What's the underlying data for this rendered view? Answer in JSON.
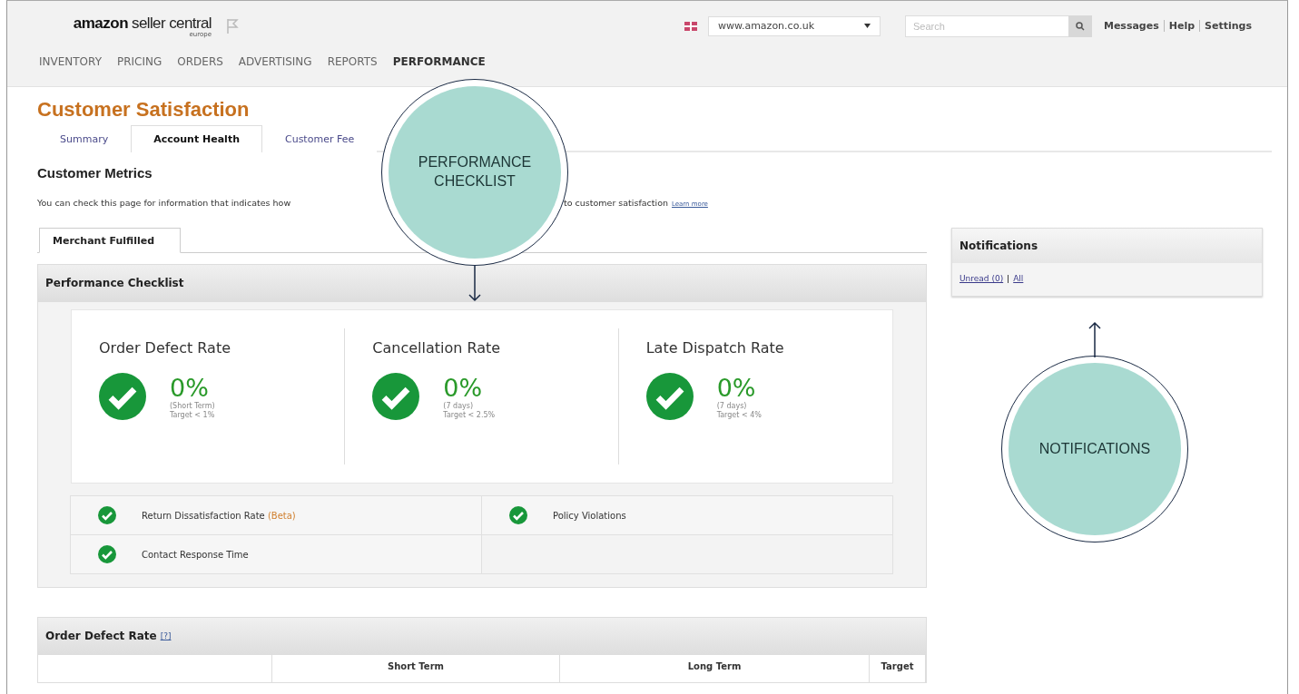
{
  "header": {
    "logo": {
      "brand": "amazon",
      "product": "seller central",
      "region": "europe"
    },
    "marketplace": "www.amazon.co.uk",
    "search": {
      "placeholder": "Search"
    },
    "links": [
      "Messages",
      "Help",
      "Settings"
    ]
  },
  "nav": [
    {
      "label": "INVENTORY",
      "selected": false
    },
    {
      "label": "PRICING",
      "selected": false
    },
    {
      "label": "ORDERS",
      "selected": false
    },
    {
      "label": "ADVERTISING",
      "selected": false
    },
    {
      "label": "REPORTS",
      "selected": false
    },
    {
      "label": "PERFORMANCE",
      "selected": true
    }
  ],
  "page_title": "Customer Satisfaction",
  "tabs": [
    {
      "label": "Summary",
      "selected": false
    },
    {
      "label": "Account Health",
      "selected": true
    },
    {
      "label": "Customer Fee",
      "selected": false
    }
  ],
  "section_title": "Customer Metrics",
  "description": [
    "You can check this page for information that indicates how",
    "to customer satisfaction"
  ],
  "learn_more": "Learn more",
  "subtabs": [
    {
      "label": "Merchant Fulfilled",
      "selected": true
    }
  ],
  "checklist": {
    "title": "Performance Checklist",
    "metrics": [
      {
        "name": "Order Defect Rate",
        "value": "0%",
        "period": "(Short Term)",
        "target": "Target < 1%",
        "passed": true
      },
      {
        "name": "Cancellation Rate",
        "value": "0%",
        "period": "(7 days)",
        "target": "Target < 2.5%",
        "passed": true
      },
      {
        "name": "Late Dispatch Rate",
        "value": "0%",
        "period": "(7 days)",
        "target": "Target < 4%",
        "passed": true
      }
    ],
    "items": [
      {
        "label": "Return Dissatisfaction Rate",
        "tag": "(Beta)",
        "passed": true
      },
      {
        "label": "Policy Violations",
        "passed": true
      },
      {
        "label": "Contact Response Time",
        "passed": true
      }
    ]
  },
  "notifications": {
    "title": "Notifications",
    "links": [
      "Unread (0)",
      "All"
    ]
  },
  "odr_panel": {
    "title": "Order Defect Rate",
    "help": "[?]",
    "columns": [
      "",
      "Short Term",
      "Long Term",
      "Target"
    ]
  },
  "callouts": [
    {
      "text": "PERFORMANCE CHECKLIST",
      "arrow_up": false
    },
    {
      "text": "NOTIFICATIONS",
      "arrow_up": true
    }
  ]
}
